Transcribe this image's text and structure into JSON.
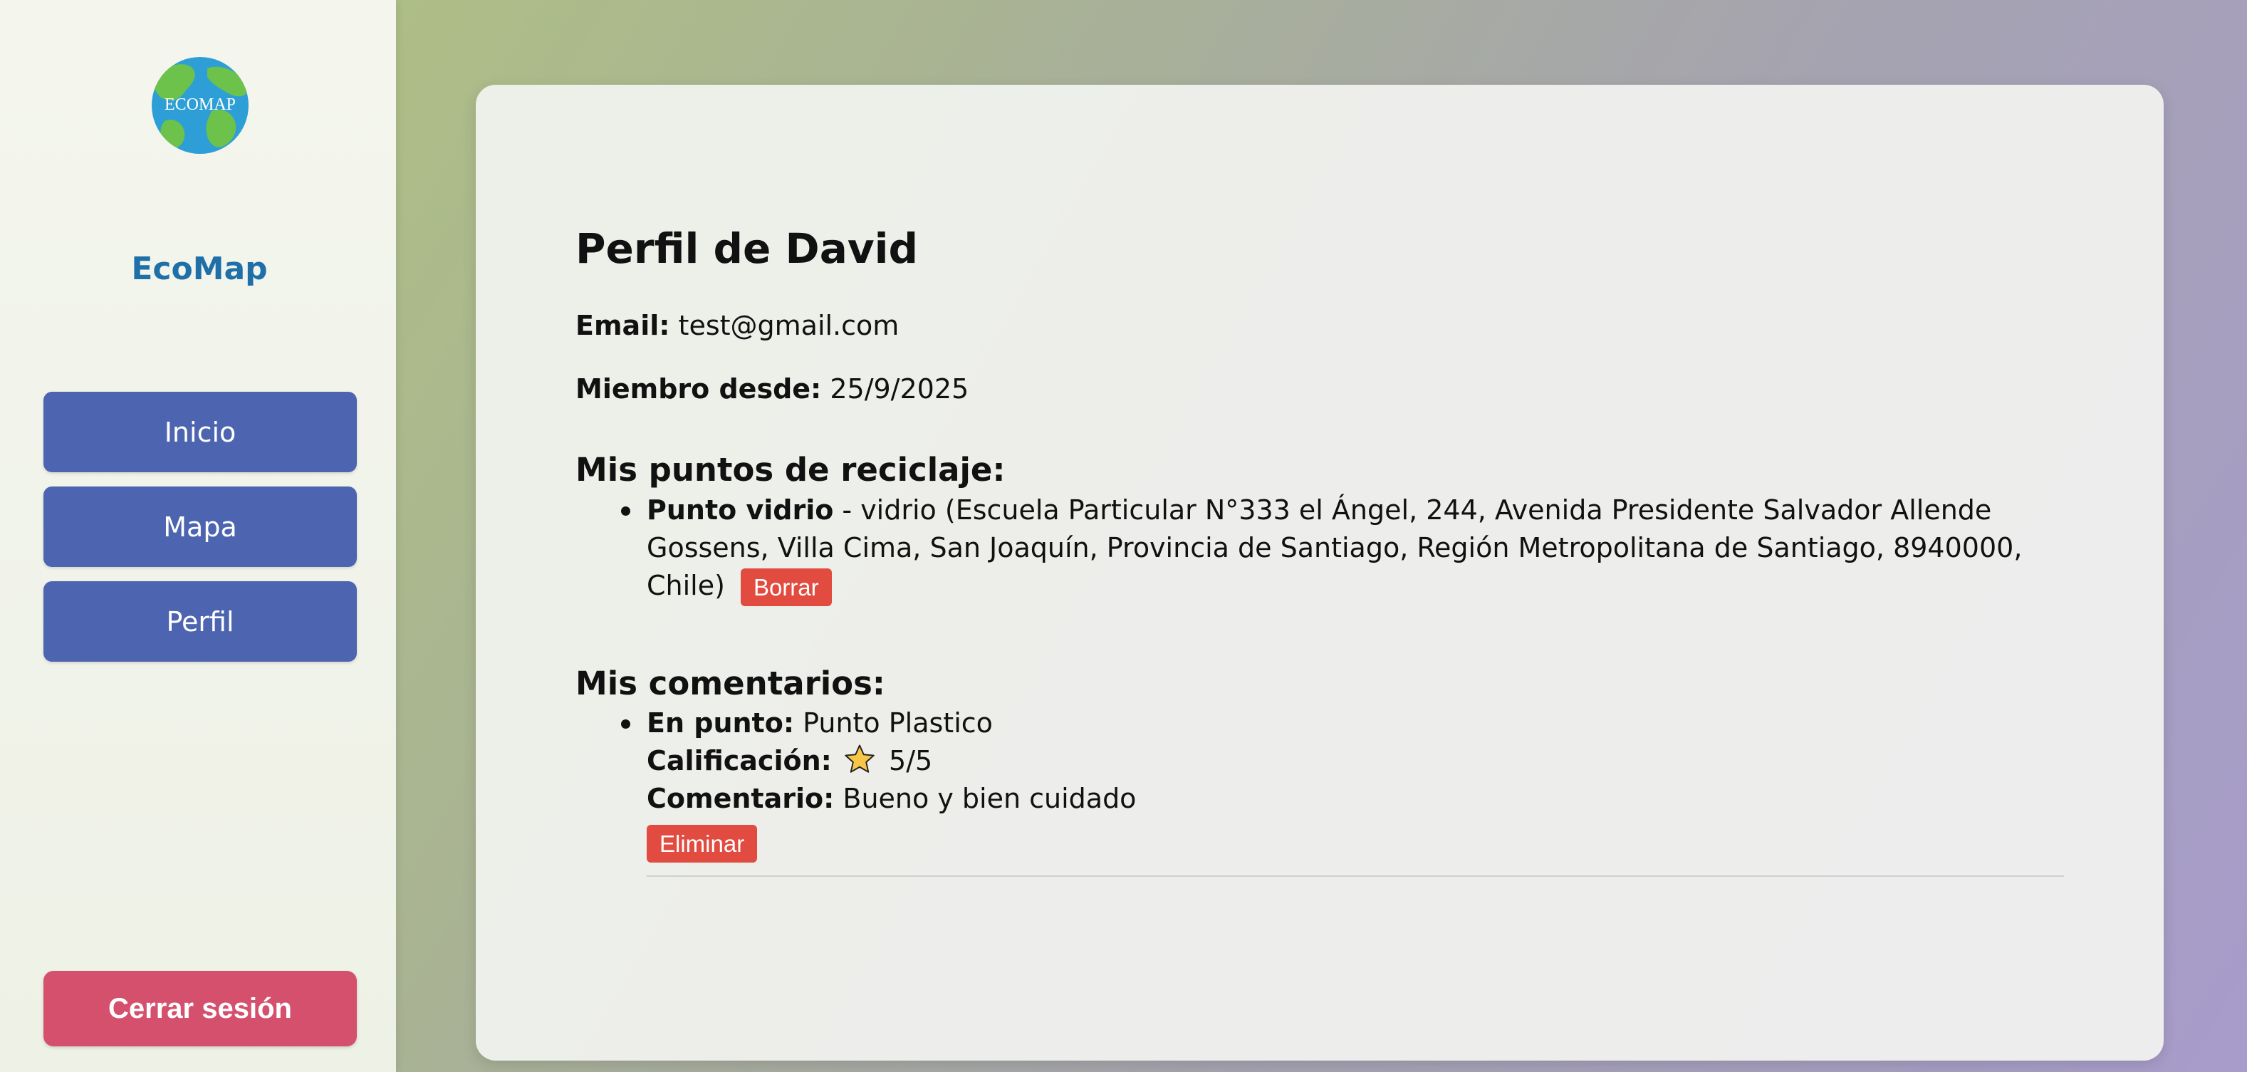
{
  "sidebar": {
    "logo_text": "ECOMAP",
    "brand": "EcoMap",
    "nav": [
      {
        "label": "Inicio"
      },
      {
        "label": "Mapa"
      },
      {
        "label": "Perfil"
      }
    ],
    "logout_label": "Cerrar sesión"
  },
  "profile": {
    "title": "Perfil de David",
    "email_label": "Email:",
    "email": "test@gmail.com",
    "since_label": "Miembro desde:",
    "since": "25/9/2025"
  },
  "points": {
    "title": "Mis puntos de reciclaje:",
    "items": [
      {
        "name": "Punto vidrio",
        "details": " - vidrio (Escuela Particular N°333 el Ángel, 244, Avenida Presidente Salvador Allende Gossens, Villa Cima, San Joaquín, Provincia de Santiago, Región Metropolitana de Santiago, 8940000, Chile)",
        "delete_label": "Borrar"
      }
    ]
  },
  "comments": {
    "title": "Mis comentarios:",
    "items": [
      {
        "point_label": "En punto:",
        "point": "Punto Plastico",
        "rating_label": "Calificación:",
        "rating": "5/5",
        "comment_label": "Comentario:",
        "comment": "Bueno y bien cuidado",
        "delete_label": "Eliminar"
      }
    ]
  },
  "colors": {
    "nav_button": "#4d65b0",
    "logout_button": "#d4506d",
    "delete_button": "#e24b3f",
    "brand": "#1f6fa8"
  }
}
